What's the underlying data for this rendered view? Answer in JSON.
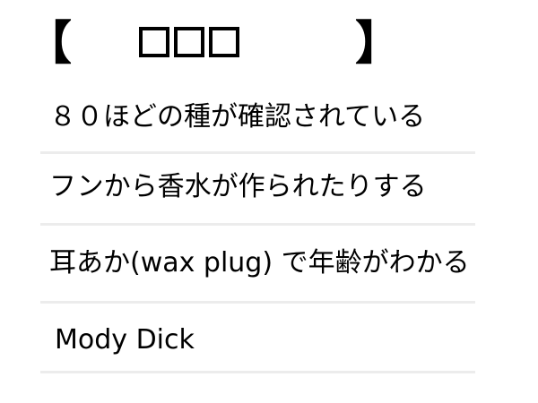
{
  "header": {
    "open_bracket": "【",
    "title_glyphs": [
      "□",
      "□",
      "□"
    ],
    "close_bracket": "】"
  },
  "items": [
    {
      "label": "８０ほどの種が確認されている"
    },
    {
      "label": "フンから香水が作られたりする"
    },
    {
      "label": "耳あか(wax plug) で年齢がわかる"
    },
    {
      "label": "Mody Dick"
    }
  ],
  "colors": {
    "text": "#000000",
    "divider": "#ececec",
    "background": "#ffffff"
  }
}
